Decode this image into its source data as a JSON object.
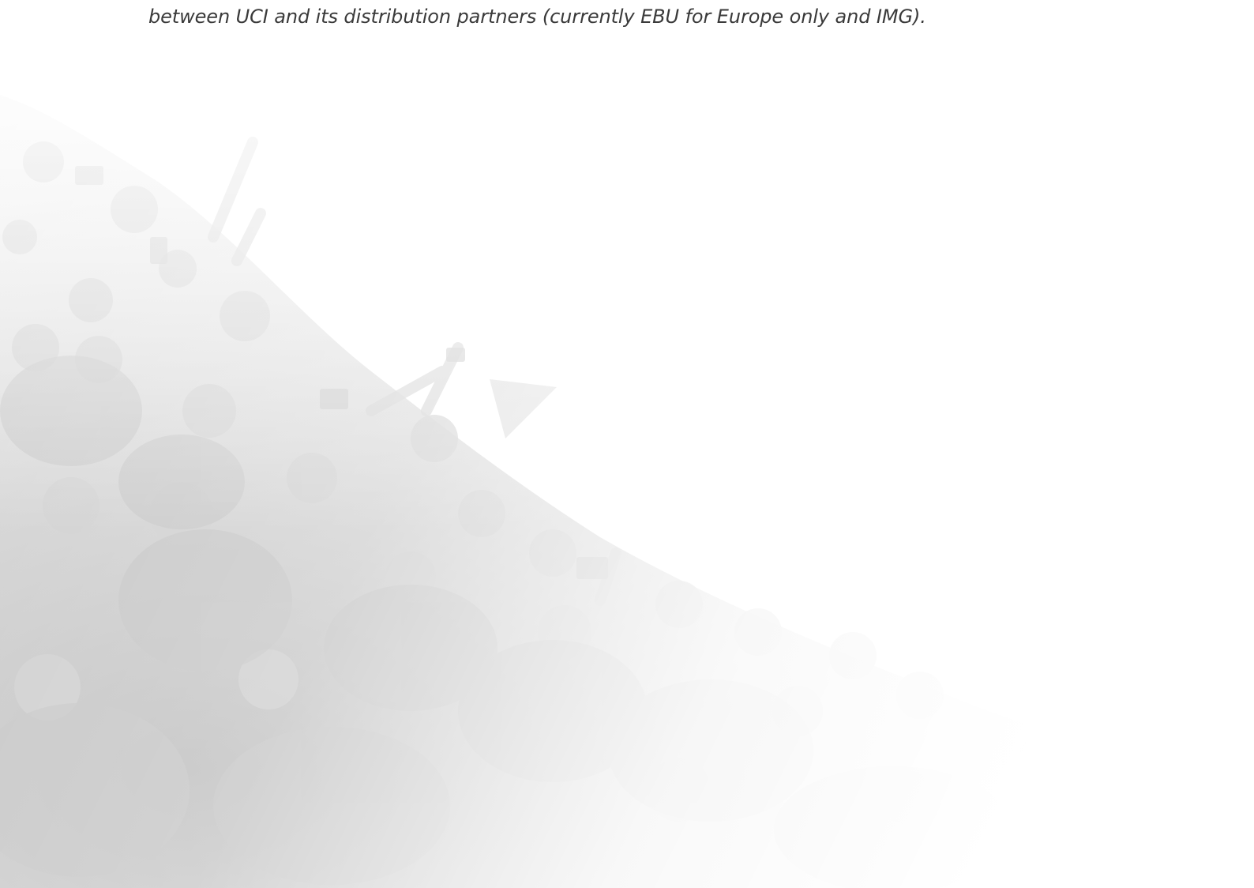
{
  "document": {
    "body_lines": [
      "between UCI and its distribution partners (currently EBU for Europe only and IMG)."
    ]
  },
  "colors": {
    "background": "#ffffff",
    "text": "#3a3a3a",
    "photo_tint": "#c8c8c8"
  }
}
